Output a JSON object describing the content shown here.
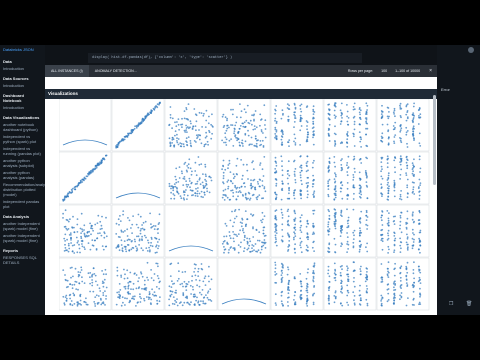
{
  "app": {
    "brand": "Databricks JSON",
    "code_line": "display( hist.df.pandas(df), {'column': 'x', 'type': 'scatter'} )",
    "right_tag": "Error",
    "bottom_input": "",
    "bottom_icons": [
      "play-icon",
      "copy-icon",
      "trash-icon"
    ]
  },
  "sidebar": {
    "items": [
      {
        "label": "Data",
        "kind": "head"
      },
      {
        "label": "Introduction",
        "kind": "sub"
      },
      {
        "label": "Data Sources",
        "kind": "head"
      },
      {
        "label": "Introduction",
        "kind": "sub"
      },
      {
        "label": "Dashboard Notebook",
        "kind": "head"
      },
      {
        "label": "Introduction",
        "kind": "sub"
      },
      {
        "label": "Data Visualizations",
        "kind": "head"
      },
      {
        "label": "another notebook dashboard (python)",
        "kind": "sub"
      },
      {
        "label": "independent vs python (spark) plot",
        "kind": "sub"
      },
      {
        "label": "independent vs running (pandas plot)",
        "kind": "sub"
      },
      {
        "label": "another python analysis (subplot)",
        "kind": "sub"
      },
      {
        "label": "another python analysis (pandas)",
        "kind": "sub"
      },
      {
        "label": "Recommendation/analytics distribution plotted (model)",
        "kind": "sub"
      },
      {
        "label": "independent pandas plot",
        "kind": "sub"
      },
      {
        "label": "Data Analysis",
        "kind": "head"
      },
      {
        "label": "another independent (spark) model (fine)",
        "kind": "sub"
      },
      {
        "label": "another independent (spark) model (fine)",
        "kind": "sub"
      },
      {
        "label": "Reports",
        "kind": "head"
      },
      {
        "label": "RESPONSES SQL DETAILS",
        "kind": "sub"
      }
    ]
  },
  "modal": {
    "tabs": [
      "ALL INSTANCES (i)",
      "ANOMALY DETECTION..."
    ],
    "rows_label": "Rows per page:",
    "rows_value": "100",
    "range_label": "1–100 of 10000",
    "title": "Visualizations",
    "close_label": "×"
  }
}
